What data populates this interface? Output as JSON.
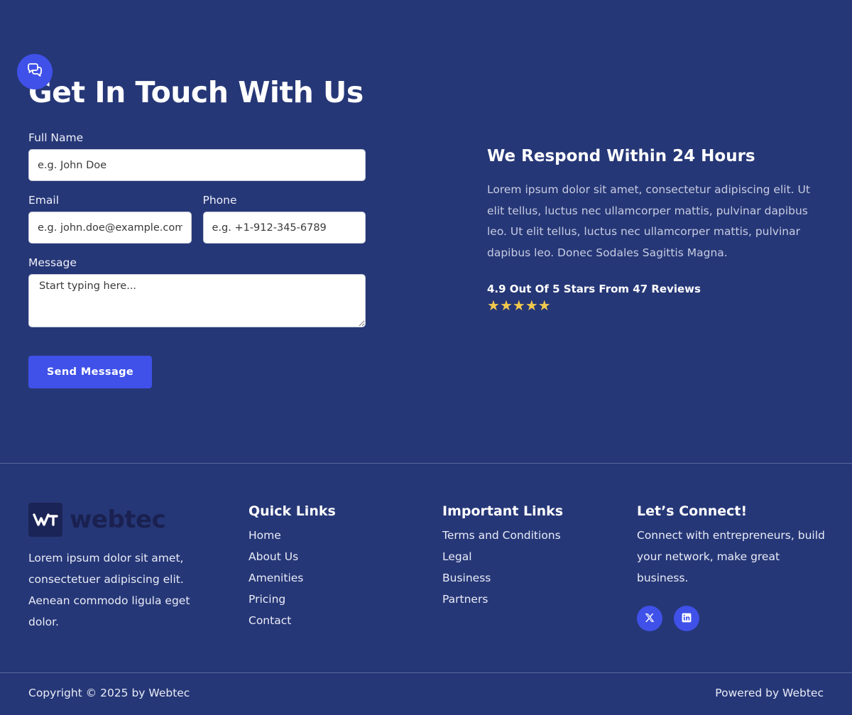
{
  "contact": {
    "title": "Get In Touch With Us",
    "form": {
      "full_name_label": "Full Name",
      "full_name_placeholder": "e.g. John Doe",
      "email_label": "Email",
      "email_placeholder": "e.g. john.doe@example.com",
      "phone_label": "Phone",
      "phone_placeholder": "e.g. +1-912-345-6789",
      "message_label": "Message",
      "message_placeholder": "Start typing here...",
      "submit_label": "Send Message"
    },
    "respond": {
      "title": "We Respond Within 24 Hours",
      "body": "Lorem ipsum dolor sit amet, consectetur adipiscing elit. Ut elit tellus, luctus nec ullamcorper mattis, pulvinar dapibus leo. Ut elit tellus, luctus nec ullamcorper mattis, pulvinar dapibus leo. Donec Sodales Sagittis Magna.",
      "rating_text": "4.9 Out Of 5 Stars From 47 Reviews",
      "stars": 5
    }
  },
  "footer": {
    "brand_name": "webtec",
    "about": "Lorem ipsum dolor sit amet, consectetuer adipiscing elit. Aenean commodo ligula eget dolor.",
    "quick_links": {
      "title": "Quick Links",
      "items": [
        "Home",
        "About Us",
        "Amenities",
        "Pricing",
        "Contact"
      ]
    },
    "important_links": {
      "title": "Important Links",
      "items": [
        "Terms and Conditions",
        "Legal",
        "Business",
        "Partners"
      ]
    },
    "connect": {
      "title": "Let’s Connect!",
      "text": "Connect with entrepreneurs, build your network, make great business.",
      "socials": [
        "x-icon",
        "linkedin-icon"
      ]
    },
    "copyright": "Copyright © 2025 by Webtec",
    "powered": "Powered by Webtec"
  },
  "colors": {
    "background": "#263777",
    "accent": "#3f51e8",
    "star": "#f2c94c"
  },
  "icons": {
    "chat": "chat-bubbles-icon",
    "star": "star-icon"
  }
}
